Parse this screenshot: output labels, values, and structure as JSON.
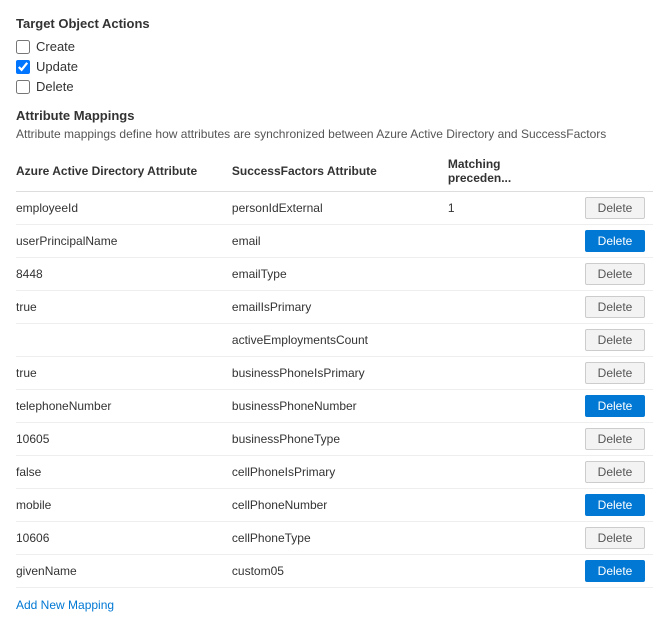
{
  "targetObjectActions": {
    "title": "Target Object Actions",
    "checkboxes": [
      {
        "id": "create",
        "label": "Create",
        "checked": false
      },
      {
        "id": "update",
        "label": "Update",
        "checked": true
      },
      {
        "id": "delete",
        "label": "Delete",
        "checked": false
      }
    ]
  },
  "attributeMappings": {
    "title": "Attribute Mappings",
    "description": "Attribute mappings define how attributes are synchronized between Azure Active Directory and SuccessFactors",
    "columns": {
      "aad": "Azure Active Directory Attribute",
      "sf": "SuccessFactors Attribute",
      "match": "Matching preceden..."
    },
    "rows": [
      {
        "aad": "employeeId",
        "sf": "personIdExternal",
        "match": "1",
        "deleteStyle": "default"
      },
      {
        "aad": "userPrincipalName",
        "sf": "email",
        "match": "",
        "deleteStyle": "primary"
      },
      {
        "aad": "8448",
        "sf": "emailType",
        "match": "",
        "deleteStyle": "default"
      },
      {
        "aad": "true",
        "sf": "emailIsPrimary",
        "match": "",
        "deleteStyle": "default"
      },
      {
        "aad": "",
        "sf": "activeEmploymentsCount",
        "match": "",
        "deleteStyle": "default"
      },
      {
        "aad": "true",
        "sf": "businessPhoneIsPrimary",
        "match": "",
        "deleteStyle": "default"
      },
      {
        "aad": "telephoneNumber",
        "sf": "businessPhoneNumber",
        "match": "",
        "deleteStyle": "primary"
      },
      {
        "aad": "10605",
        "sf": "businessPhoneType",
        "match": "",
        "deleteStyle": "default"
      },
      {
        "aad": "false",
        "sf": "cellPhoneIsPrimary",
        "match": "",
        "deleteStyle": "default"
      },
      {
        "aad": "mobile",
        "sf": "cellPhoneNumber",
        "match": "",
        "deleteStyle": "primary"
      },
      {
        "aad": "10606",
        "sf": "cellPhoneType",
        "match": "",
        "deleteStyle": "default"
      },
      {
        "aad": "givenName",
        "sf": "custom05",
        "match": "",
        "deleteStyle": "primary"
      }
    ],
    "deleteLabel": "Delete",
    "addNewMapping": "Add New Mapping"
  }
}
